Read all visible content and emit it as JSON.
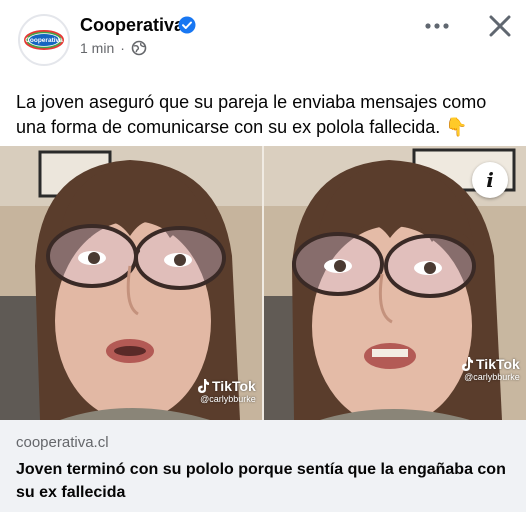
{
  "post": {
    "page_name": "Cooperativa",
    "time": "1 min",
    "separator": "·",
    "text": "La joven aseguró que su pareja le enviaba mensajes como una forma de comunicarse con su ex pololа fallecida. 👇"
  },
  "avatar": {
    "logo_text": "Cooperativa",
    "logo_subtext": "desde 1935"
  },
  "media": {
    "watermark_left": {
      "brand": "TikTok",
      "handle": "@carlybburke"
    },
    "watermark_right": {
      "brand": "TikTok",
      "handle": "@carlybburke"
    },
    "info_label": "i"
  },
  "link": {
    "domain": "cooperativa.cl",
    "title": "Joven terminó con su pololo porque sentía que la engañaba con su ex fallecida"
  },
  "colors": {
    "verified": "#1877f2",
    "secondary_text": "#65676b",
    "preview_bg": "#f0f2f5"
  },
  "icons": [
    "verified-badge-icon",
    "globe-icon",
    "more-icon",
    "close-icon",
    "info-icon",
    "tiktok-icon",
    "pointing-down-emoji"
  ]
}
